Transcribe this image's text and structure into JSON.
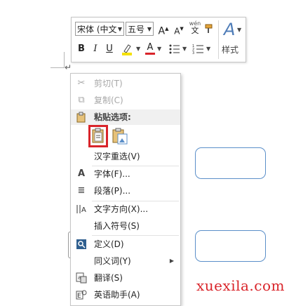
{
  "document": {
    "paragraph_mark": "↵"
  },
  "mini_toolbar": {
    "font_name": "宋体 (中文",
    "font_size": "五号",
    "grow_font": "A",
    "shrink_font": "A",
    "phonetic_guide": "wén",
    "phonetic_char": "文",
    "bold": "B",
    "italic": "I",
    "underline": "U",
    "font_color_glyph": "A",
    "styles_label": "样式"
  },
  "context_menu": {
    "items": [
      {
        "label": "剪切(T)",
        "icon": "scissors-icon",
        "enabled": false
      },
      {
        "label": "复制(C)",
        "icon": "copy-icon",
        "enabled": false
      },
      {
        "label": "粘贴选项:",
        "icon": "clipboard-icon",
        "enabled": true
      },
      {
        "label": "汉字重选(V)",
        "icon": "",
        "enabled": true
      },
      {
        "label": "字体(F)...",
        "icon": "font-icon",
        "enabled": true
      },
      {
        "label": "段落(P)...",
        "icon": "paragraph-icon",
        "enabled": true
      },
      {
        "label": "文字方向(X)...",
        "icon": "text-direction-icon",
        "enabled": true
      },
      {
        "label": "插入符号(S)",
        "icon": "",
        "enabled": true
      },
      {
        "label": "定义(D)",
        "icon": "define-icon",
        "enabled": true
      },
      {
        "label": "同义词(Y)",
        "icon": "",
        "enabled": true
      },
      {
        "label": "翻译(S)",
        "icon": "translate-icon",
        "enabled": true
      },
      {
        "label": "英语助手(A)",
        "icon": "english-assistant-icon",
        "enabled": true
      }
    ],
    "paste_options": [
      {
        "icon": "keep-text-only-icon",
        "selected": true
      },
      {
        "icon": "paste-picture-icon",
        "selected": false
      }
    ]
  },
  "watermark": "xuexila.com",
  "colors": {
    "highlight": "#f5e100",
    "font_red": "#d9242a",
    "shape_border": "#5b8fc9"
  }
}
